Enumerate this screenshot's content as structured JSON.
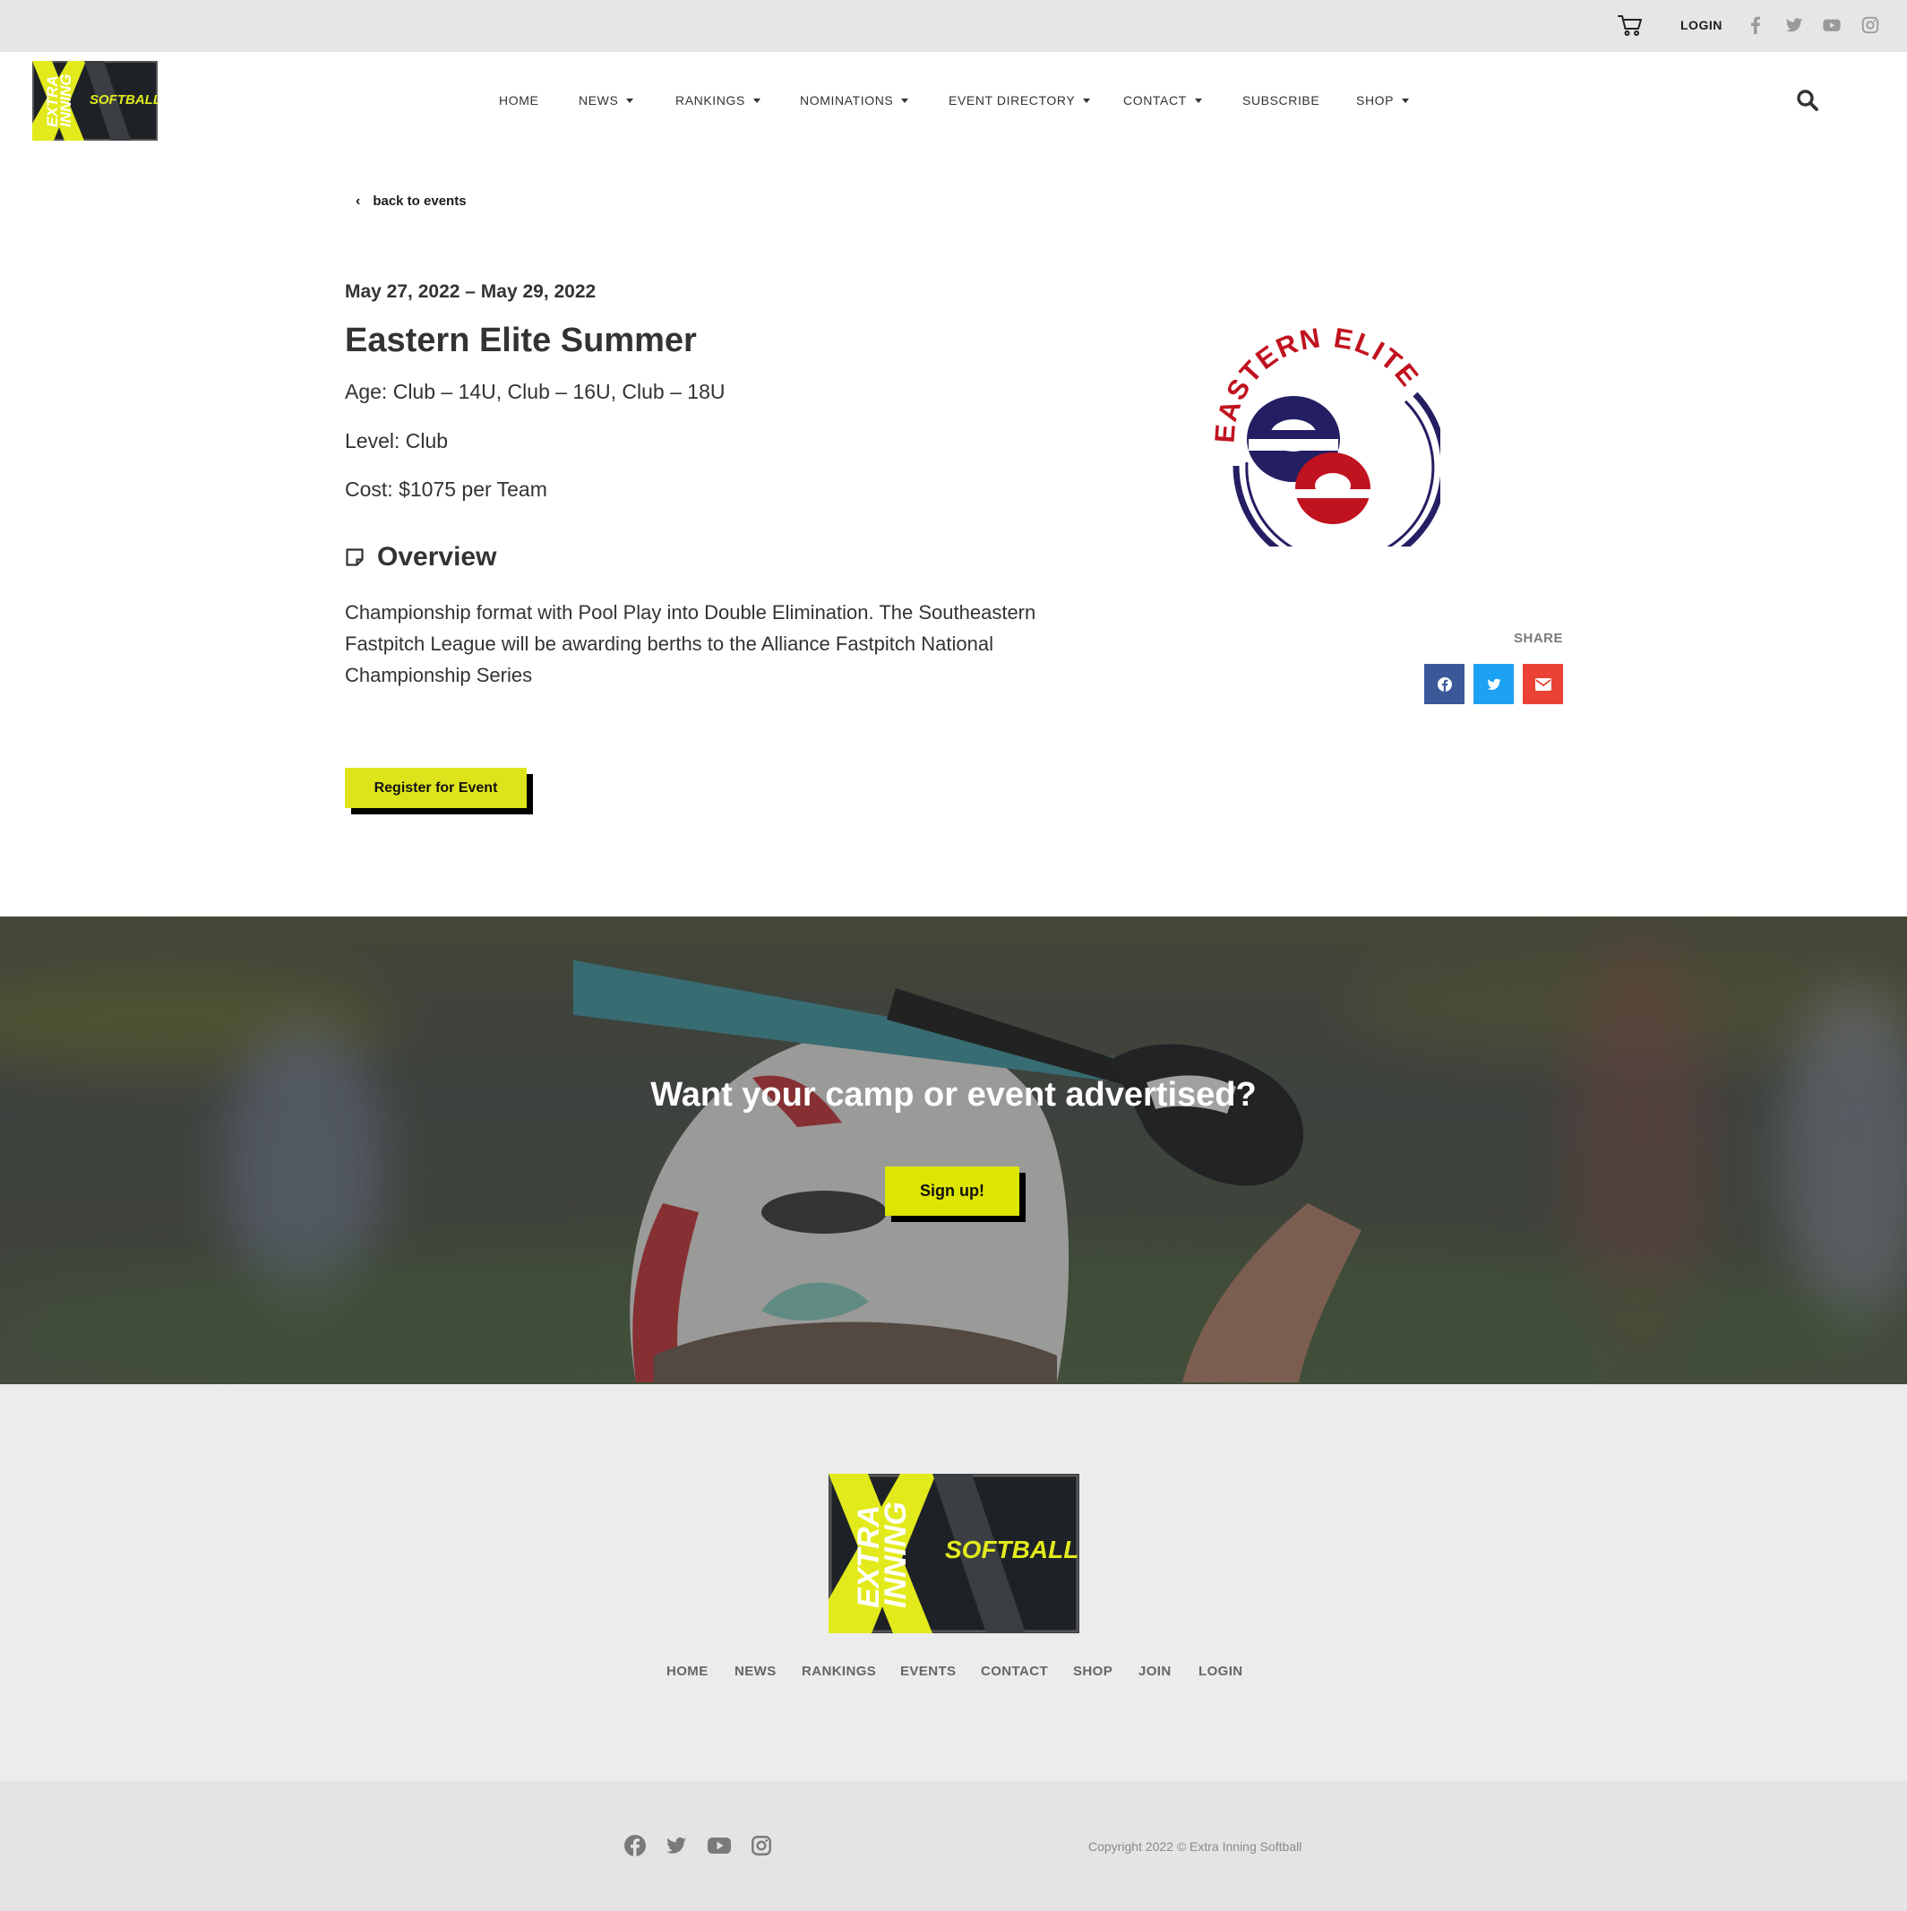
{
  "topbar": {
    "login_label": "LOGIN",
    "icons": [
      "cart-icon",
      "facebook-icon",
      "twitter-icon",
      "youtube-icon",
      "instagram-icon"
    ]
  },
  "header": {
    "logo": {
      "line1": "EXTRA",
      "line2": "INNING",
      "word": "SOFTBALL"
    },
    "nav": [
      {
        "label": "HOME",
        "dropdown": false
      },
      {
        "label": "NEWS",
        "dropdown": true
      },
      {
        "label": "RANKINGS",
        "dropdown": true
      },
      {
        "label": "NOMINATIONS",
        "dropdown": true
      },
      {
        "label": "EVENT DIRECTORY",
        "dropdown": true
      },
      {
        "label": "CONTACT",
        "dropdown": true
      },
      {
        "label": "SUBSCRIBE",
        "dropdown": false
      },
      {
        "label": "SHOP",
        "dropdown": true
      }
    ]
  },
  "event": {
    "back_label": "back to events",
    "dates": "May 27, 2022 – May 29, 2022",
    "title": "Eastern Elite Summer",
    "age": "Age: Club – 14U, Club – 16U, Club – 18U",
    "level": "Level: Club",
    "cost": "Cost: $1075 per Team",
    "overview_heading": "Overview",
    "overview_text": "Championship format with Pool Play into Double Elimination. The Southeastern Fastpitch League will be awarding berths to the Alliance Fastpitch National Championship Series",
    "register_label": "Register for Event",
    "logo_text": "EASTERN ELITE"
  },
  "share": {
    "label": "SHARE",
    "buttons": [
      {
        "name": "facebook",
        "color": "#3b5998"
      },
      {
        "name": "twitter",
        "color": "#1da1f2"
      },
      {
        "name": "email",
        "color": "#ea4335"
      }
    ]
  },
  "banner": {
    "title": "Want your camp or event advertised?",
    "signup_label": "Sign up!"
  },
  "footer": {
    "nav": [
      "HOME",
      "NEWS",
      "RANKINGS",
      "EVENTS",
      "CONTACT",
      "SHOP",
      "JOIN",
      "LOGIN"
    ],
    "copyright": "Copyright 2022 © Extra Inning Softball"
  },
  "colors": {
    "accent_yellow": "#dde41b",
    "logo_dark": "#1e2226",
    "ee_navy": "#241f63",
    "ee_red": "#c1121f"
  }
}
